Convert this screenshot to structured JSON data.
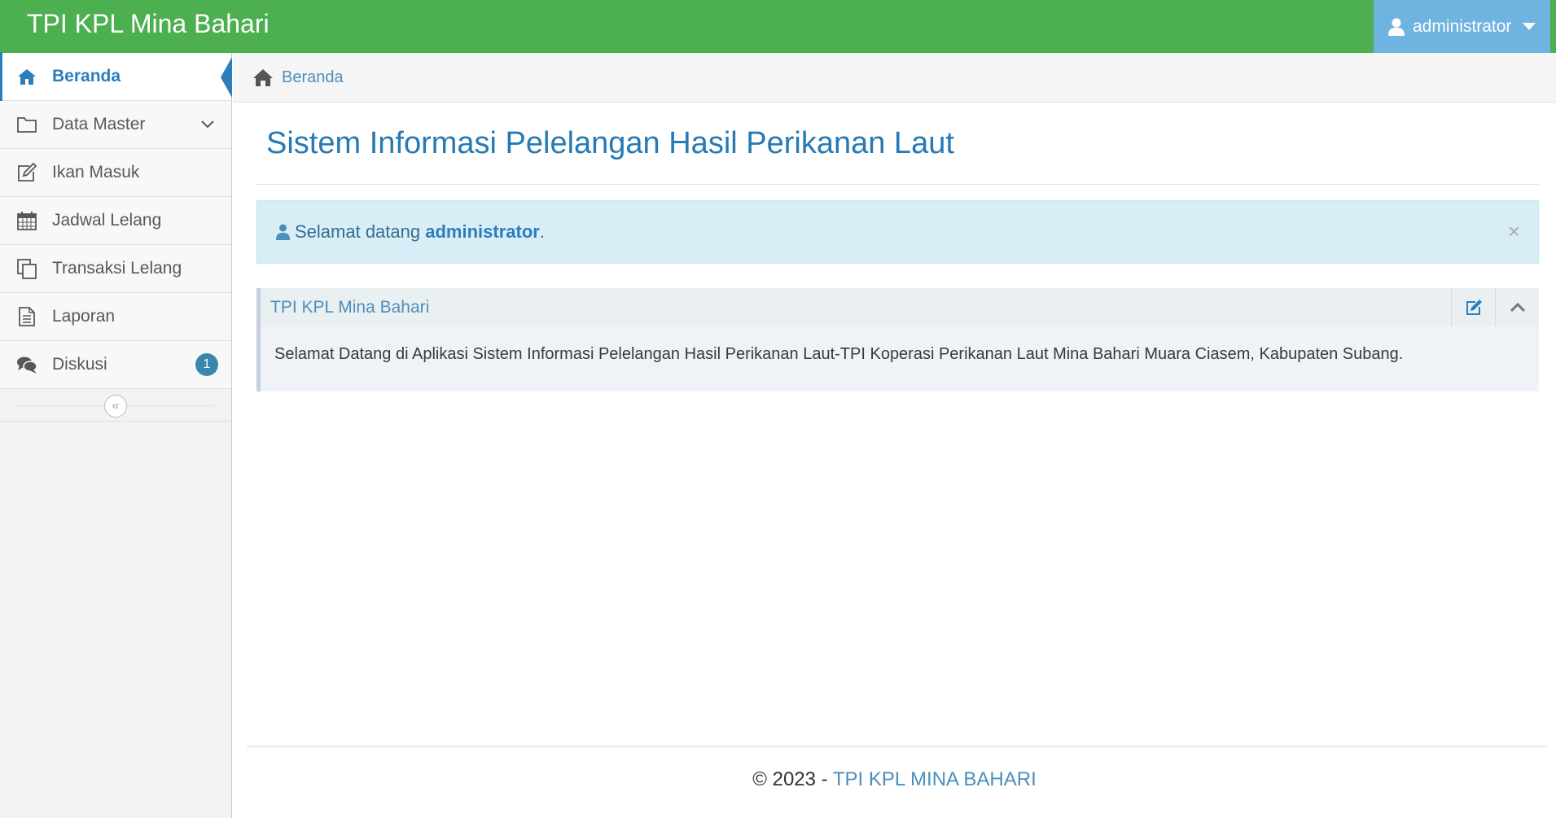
{
  "navbar": {
    "brand": "TPI KPL Mina Bahari",
    "user": "administrator",
    "colors": {
      "navbar_bg": "#4caf50",
      "user_menu_bg": "#6fb3e0"
    }
  },
  "sidebar": {
    "items": [
      {
        "label": "Beranda",
        "icon": "home-icon",
        "active": true
      },
      {
        "label": "Data Master",
        "icon": "folder-icon",
        "has_submenu": true
      },
      {
        "label": "Ikan Masuk",
        "icon": "edit-icon"
      },
      {
        "label": "Jadwal Lelang",
        "icon": "calendar-icon"
      },
      {
        "label": "Transaksi Lelang",
        "icon": "copy-icon"
      },
      {
        "label": "Laporan",
        "icon": "file-text-icon"
      },
      {
        "label": "Diskusi",
        "icon": "comments-icon",
        "badge": "1"
      }
    ],
    "collapse_icon": "double-angle-left-icon"
  },
  "breadcrumb": {
    "home": "Beranda"
  },
  "main": {
    "title": "Sistem Informasi Pelelangan Hasil Perikanan Laut",
    "alert": {
      "prefix": "Selamat datang",
      "user": "administrator",
      "suffix": ".",
      "close": "×"
    },
    "widget": {
      "title": "TPI KPL Mina Bahari",
      "body": "Selamat Datang di Aplikasi Sistem Informasi Pelelangan Hasil Perikanan Laut-TPI Koperasi Perikanan Laut Mina Bahari Muara Ciasem, Kabupaten Subang.",
      "tools": [
        "edit-icon",
        "chevron-up-icon"
      ]
    }
  },
  "footer": {
    "prefix": "© 2023 - ",
    "brand": "TPI KPL MINA BAHARI"
  }
}
